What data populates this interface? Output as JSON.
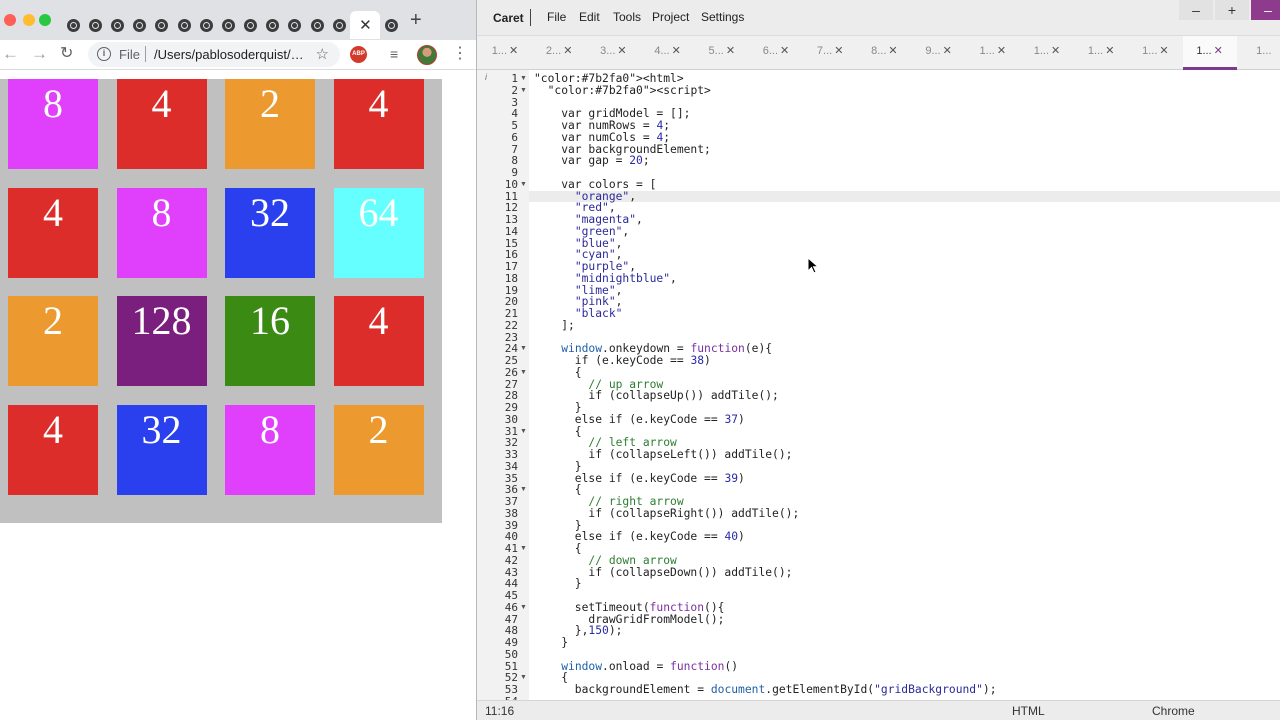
{
  "browser": {
    "tab_count": 15,
    "active_tab_close": "✕",
    "new_tab": "+",
    "url_scheme": "File",
    "url": "/Users/pablosoderquist/…",
    "abp_label": "ABP"
  },
  "game": {
    "tiles": [
      {
        "value": "8",
        "color": "#e040fb",
        "row": 0,
        "col": 0
      },
      {
        "value": "4",
        "color": "#dc2d2a",
        "row": 0,
        "col": 1
      },
      {
        "value": "2",
        "color": "#ec9a30",
        "row": 0,
        "col": 2
      },
      {
        "value": "4",
        "color": "#dc2d2a",
        "row": 0,
        "col": 3
      },
      {
        "value": "4",
        "color": "#dc2d2a",
        "row": 1,
        "col": 0
      },
      {
        "value": "8",
        "color": "#e040fb",
        "row": 1,
        "col": 1
      },
      {
        "value": "32",
        "color": "#2a40ef",
        "row": 1,
        "col": 2
      },
      {
        "value": "64",
        "color": "#66ffff",
        "row": 1,
        "col": 3
      },
      {
        "value": "2",
        "color": "#ec9a30",
        "row": 2,
        "col": 0
      },
      {
        "value": "128",
        "color": "#7b1f7e",
        "row": 2,
        "col": 1
      },
      {
        "value": "16",
        "color": "#3a8a14",
        "row": 2,
        "col": 2
      },
      {
        "value": "4",
        "color": "#dc2d2a",
        "row": 2,
        "col": 3
      },
      {
        "value": "4",
        "color": "#dc2d2a",
        "row": 3,
        "col": 0
      },
      {
        "value": "32",
        "color": "#2a40ef",
        "row": 3,
        "col": 1
      },
      {
        "value": "8",
        "color": "#e040fb",
        "row": 3,
        "col": 2
      },
      {
        "value": "2",
        "color": "#ec9a30",
        "row": 3,
        "col": 3
      }
    ]
  },
  "editor": {
    "app_name": "Caret",
    "menu": [
      "File",
      "Edit",
      "Tools",
      "Project",
      "Settings"
    ],
    "window_buttons": {
      "minimize": "–",
      "maximize": "+",
      "close": "–"
    },
    "tabs": [
      "1...",
      "2...",
      "3...",
      "4...",
      "5...",
      "6...",
      "7...",
      "8...",
      "9...",
      "1...",
      "1...",
      "1...",
      "1...",
      "1...",
      "1..."
    ],
    "active_tab_index": 13,
    "tab_close": "✕",
    "code_lines": [
      "<html>",
      "  <script>",
      "",
      "    var gridModel = [];",
      "    var numRows = 4;",
      "    var numCols = 4;",
      "    var backgroundElement;",
      "    var gap = 20;",
      "",
      "    var colors = [",
      "      \"orange\",",
      "      \"red\",",
      "      \"magenta\",",
      "      \"green\",",
      "      \"blue\",",
      "      \"cyan\",",
      "      \"purple\",",
      "      \"midnightblue\",",
      "      \"lime\",",
      "      \"pink\",",
      "      \"black\"",
      "    ];",
      "",
      "    window.onkeydown = function(e){",
      "      if (e.keyCode == 38)",
      "      {",
      "        // up arrow",
      "        if (collapseUp()) addTile();",
      "      }",
      "      else if (e.keyCode == 37)",
      "      {",
      "        // left arrow",
      "        if (collapseLeft()) addTile();",
      "      }",
      "      else if (e.keyCode == 39)",
      "      {",
      "        // right arrow",
      "        if (collapseRight()) addTile();",
      "      }",
      "      else if (e.keyCode == 40)",
      "      {",
      "        // down arrow",
      "        if (collapseDown()) addTile();",
      "      }",
      "",
      "      setTimeout(function(){",
      "        drawGridFromModel();",
      "      },150);",
      "    }",
      "",
      "    window.onload = function()",
      "    {",
      "      backgroundElement = document.getElementById(\"gridBackground\");",
      ""
    ],
    "fold_lines": [
      1,
      2,
      10,
      24,
      26,
      31,
      36,
      41,
      46,
      52
    ],
    "highlight_line": 11,
    "status": {
      "position": "11:16",
      "mode": "HTML",
      "env": "Chrome"
    },
    "syntax_colors": {
      "keyword": "#222222",
      "tag": "#7b2fa0",
      "string": "#2a2a9a",
      "number": "#2a2aa8",
      "comment": "#2e7d32",
      "builtin": "#1f5fa8"
    }
  }
}
